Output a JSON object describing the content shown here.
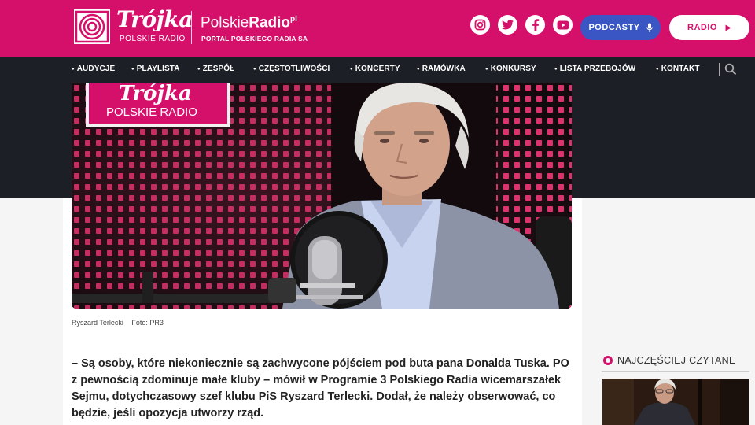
{
  "header": {
    "brand_name": "Trójka",
    "brand_sub": "POLSKIE RADIO",
    "portal_name_light": "Polskie",
    "portal_name_bold": "Radio",
    "portal_suffix": "pl",
    "portal_sub": "PORTAL POLSKIEGO RADIA SA",
    "social_icons": [
      "instagram-icon",
      "twitter-icon",
      "facebook-icon",
      "youtube-icon"
    ],
    "podcasty_label": "PODCASTY",
    "radio_label": "RADIO",
    "accent_color": "#d5106b",
    "podcasty_color": "#3a56c5"
  },
  "nav": {
    "items": [
      "AUDYCJE",
      "PLAYLISTA",
      "ZESPÓŁ",
      "CZĘSTOTLIWOŚCI",
      "KONCERTY",
      "RAMÓWKA",
      "KONKURSY",
      "LISTA PRZEBOJÓW",
      "KONTAKT"
    ]
  },
  "article": {
    "photo_studio_brand": "Trójka",
    "photo_studio_sub": "POLSKIE RADIO",
    "caption_name": "Ryszard Terlecki",
    "caption_credit": "Foto: PR3",
    "lead": "– Są osoby, które niekoniecznie są zachwycone pójściem pod buta pana Donalda Tuska. PO z pewnością zdominuje małe kluby – mówił w Programie 3 Polskiego Radia wicemarszałek Sejmu, dotychczasowy szef klubu PiS Ryszard Terlecki. Dodał, że należy obserwować, co będzie, jeśli opozycja utworzy rząd."
  },
  "sidebar": {
    "most_read_title": "NAJCZĘŚCIEJ CZYTANE"
  }
}
